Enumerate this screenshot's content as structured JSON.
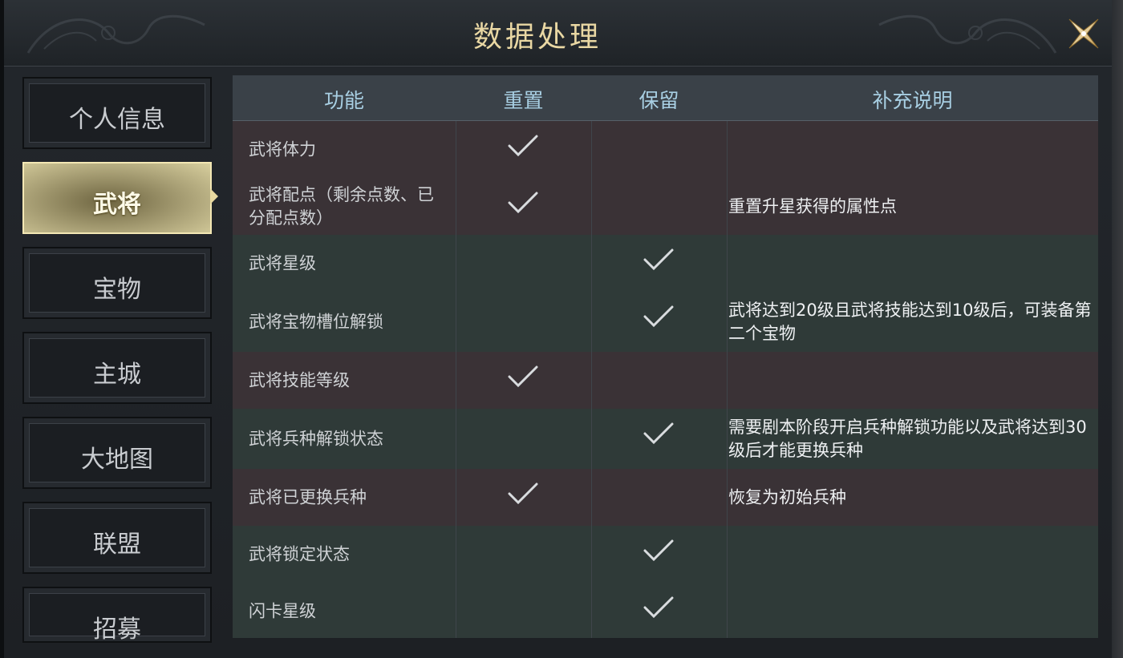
{
  "header": {
    "title": "数据处理"
  },
  "sidebar": {
    "items": [
      {
        "label": "个人信息",
        "active": false
      },
      {
        "label": "武将",
        "active": true
      },
      {
        "label": "宝物",
        "active": false
      },
      {
        "label": "主城",
        "active": false
      },
      {
        "label": "大地图",
        "active": false
      },
      {
        "label": "联盟",
        "active": false
      },
      {
        "label": "招募",
        "active": false
      }
    ]
  },
  "table": {
    "headers": [
      "功能",
      "重置",
      "保留",
      "补充说明"
    ],
    "rows": [
      {
        "function": "武将体力",
        "reset": true,
        "keep": false,
        "note": ""
      },
      {
        "function": "武将配点（剩余点数、已分配点数）",
        "reset": true,
        "keep": false,
        "note": "重置升星获得的属性点"
      },
      {
        "function": "武将星级",
        "reset": false,
        "keep": true,
        "note": ""
      },
      {
        "function": "武将宝物槽位解锁",
        "reset": false,
        "keep": true,
        "note": "武将达到20级且武将技能达到10级后，可装备第二个宝物"
      },
      {
        "function": "武将技能等级",
        "reset": true,
        "keep": false,
        "note": ""
      },
      {
        "function": "武将兵种解锁状态",
        "reset": false,
        "keep": true,
        "note": "需要剧本阶段开启兵种解锁功能以及武将达到30级后才能更换兵种"
      },
      {
        "function": "武将已更换兵种",
        "reset": true,
        "keep": false,
        "note": "恢复为初始兵种"
      },
      {
        "function": "武将锁定状态",
        "reset": false,
        "keep": true,
        "note": ""
      },
      {
        "function": "闪卡星级",
        "reset": false,
        "keep": true,
        "note": ""
      }
    ]
  },
  "colors": {
    "title": "#e9d7a3",
    "header_text": "#a8cfe3",
    "reset_row_tint": "#3a3236",
    "keep_row_tint": "#2f3a38",
    "active_tab": "#d8cf9e"
  }
}
